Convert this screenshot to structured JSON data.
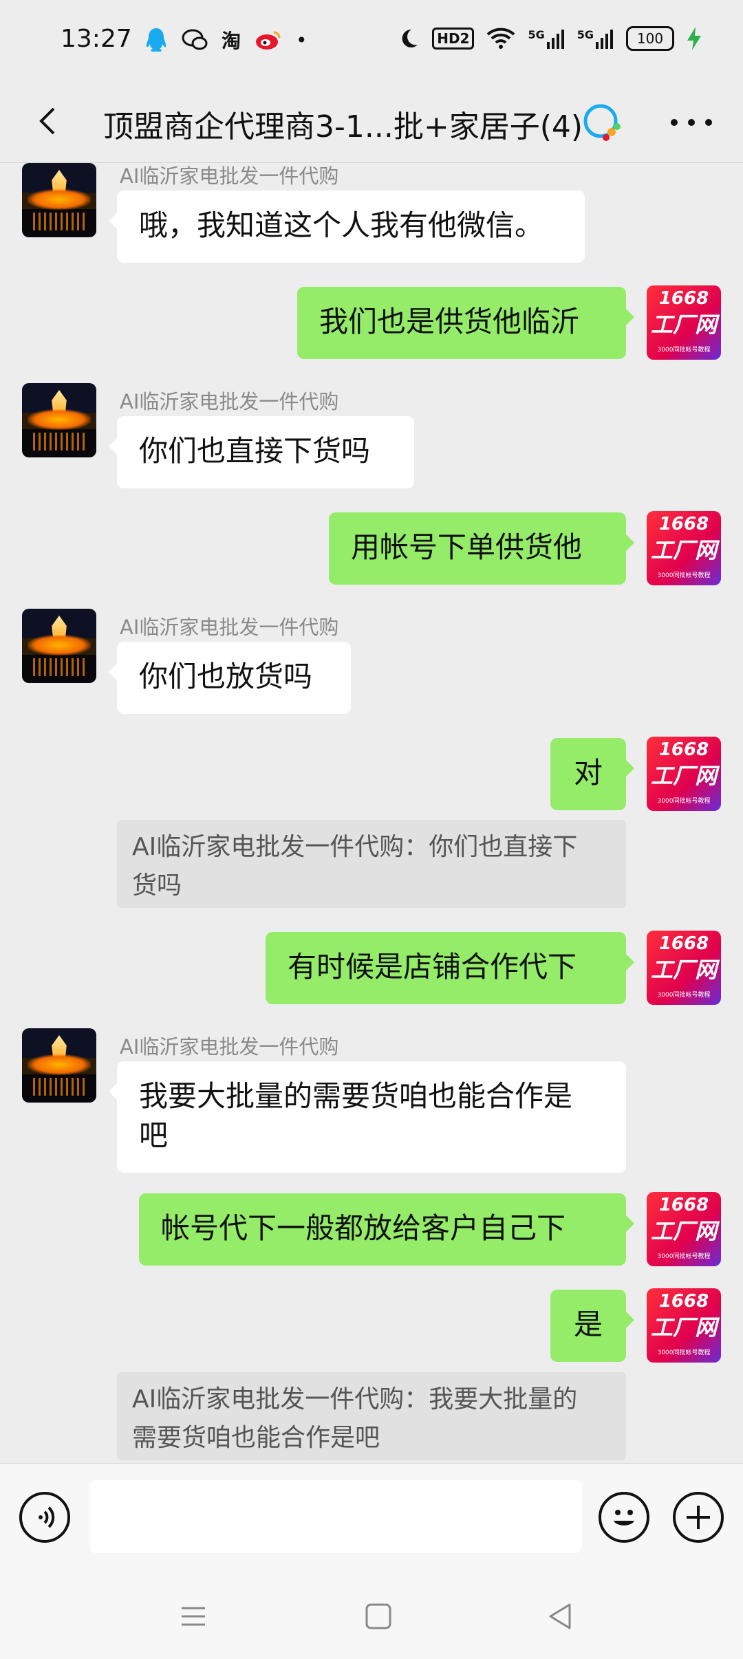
{
  "status_bar": {
    "time": "13:27",
    "left_icons": [
      "qq-icon",
      "wechat-icon",
      "taobao-icon",
      "weibo-icon",
      "dot-icon"
    ],
    "taobao_glyph": "淘",
    "dot": "•",
    "hd_label": "HD2",
    "net1": "5G",
    "net2": "5G",
    "battery": "100"
  },
  "header": {
    "title": "顶盟商企代理商3-1...批+家居子(4)"
  },
  "messages": [
    {
      "dir": "in",
      "sender": "AI临沂家电批发一件代购",
      "text": "哦，我知道这个人我有他微信。"
    },
    {
      "dir": "out",
      "text": "我们也是供货他临沂"
    },
    {
      "dir": "in",
      "sender": "AI临沂家电批发一件代购",
      "text": "你们也直接下货吗"
    },
    {
      "dir": "out",
      "text": "用帐号下单供货他"
    },
    {
      "dir": "in",
      "sender": "AI临沂家电批发一件代购",
      "text": "你们也放货吗"
    },
    {
      "dir": "out",
      "text": "对"
    },
    {
      "dir": "quote",
      "line1": "AI临沂家电批发一件代购：你们也直接下",
      "line2": "货吗"
    },
    {
      "dir": "out",
      "text": "有时候是店铺合作代下"
    },
    {
      "dir": "in",
      "sender": "AI临沂家电批发一件代购",
      "line1": "我要大批量的需要货咱也能合作是",
      "line2": "吧"
    },
    {
      "dir": "out",
      "text": "帐号代下一般都放给客户自己下"
    },
    {
      "dir": "out",
      "text": "是"
    },
    {
      "dir": "quote",
      "line1": "AI临沂家电批发一件代购：我要大批量的",
      "line2": "需要货咱也能合作是吧"
    }
  ],
  "right_avatar": {
    "line1": "1668",
    "line2": "工厂网",
    "line3": "3000同批帐号教程"
  },
  "input_bar": {
    "placeholder": ""
  },
  "nav_bar": {
    "items": [
      "menu-icon",
      "home-icon",
      "back-triangle-icon"
    ]
  }
}
